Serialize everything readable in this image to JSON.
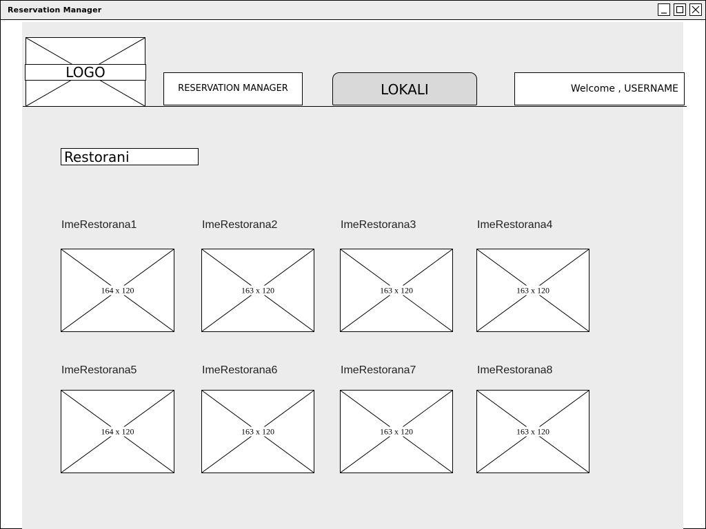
{
  "window": {
    "title": "Reservation Manager",
    "controls": [
      "minimize",
      "maximize",
      "close"
    ]
  },
  "header": {
    "logo_label": "LOGO",
    "nav_reservation_manager": "RESERVATION MANAGER",
    "nav_lokali": "LOKALI",
    "welcome_text": "Welcome , USERNAME"
  },
  "section": {
    "title": "Restorani"
  },
  "restaurants": [
    {
      "name": "ImeRestorana1",
      "image_label": "164 x 120"
    },
    {
      "name": "ImeRestorana2",
      "image_label": "163 x 120"
    },
    {
      "name": "ImeRestorana3",
      "image_label": "163 x 120"
    },
    {
      "name": "ImeRestorana4",
      "image_label": "163 x 120"
    },
    {
      "name": "ImeRestorana5",
      "image_label": "164 x 120"
    },
    {
      "name": "ImeRestorana6",
      "image_label": "163 x 120"
    },
    {
      "name": "ImeRestorana7",
      "image_label": "163 x 120"
    },
    {
      "name": "ImeRestorana8",
      "image_label": "163 x 120"
    }
  ],
  "colors": {
    "canvas_background": "#ececec",
    "active_tab": "#d9d9d9",
    "stroke": "#000000"
  }
}
